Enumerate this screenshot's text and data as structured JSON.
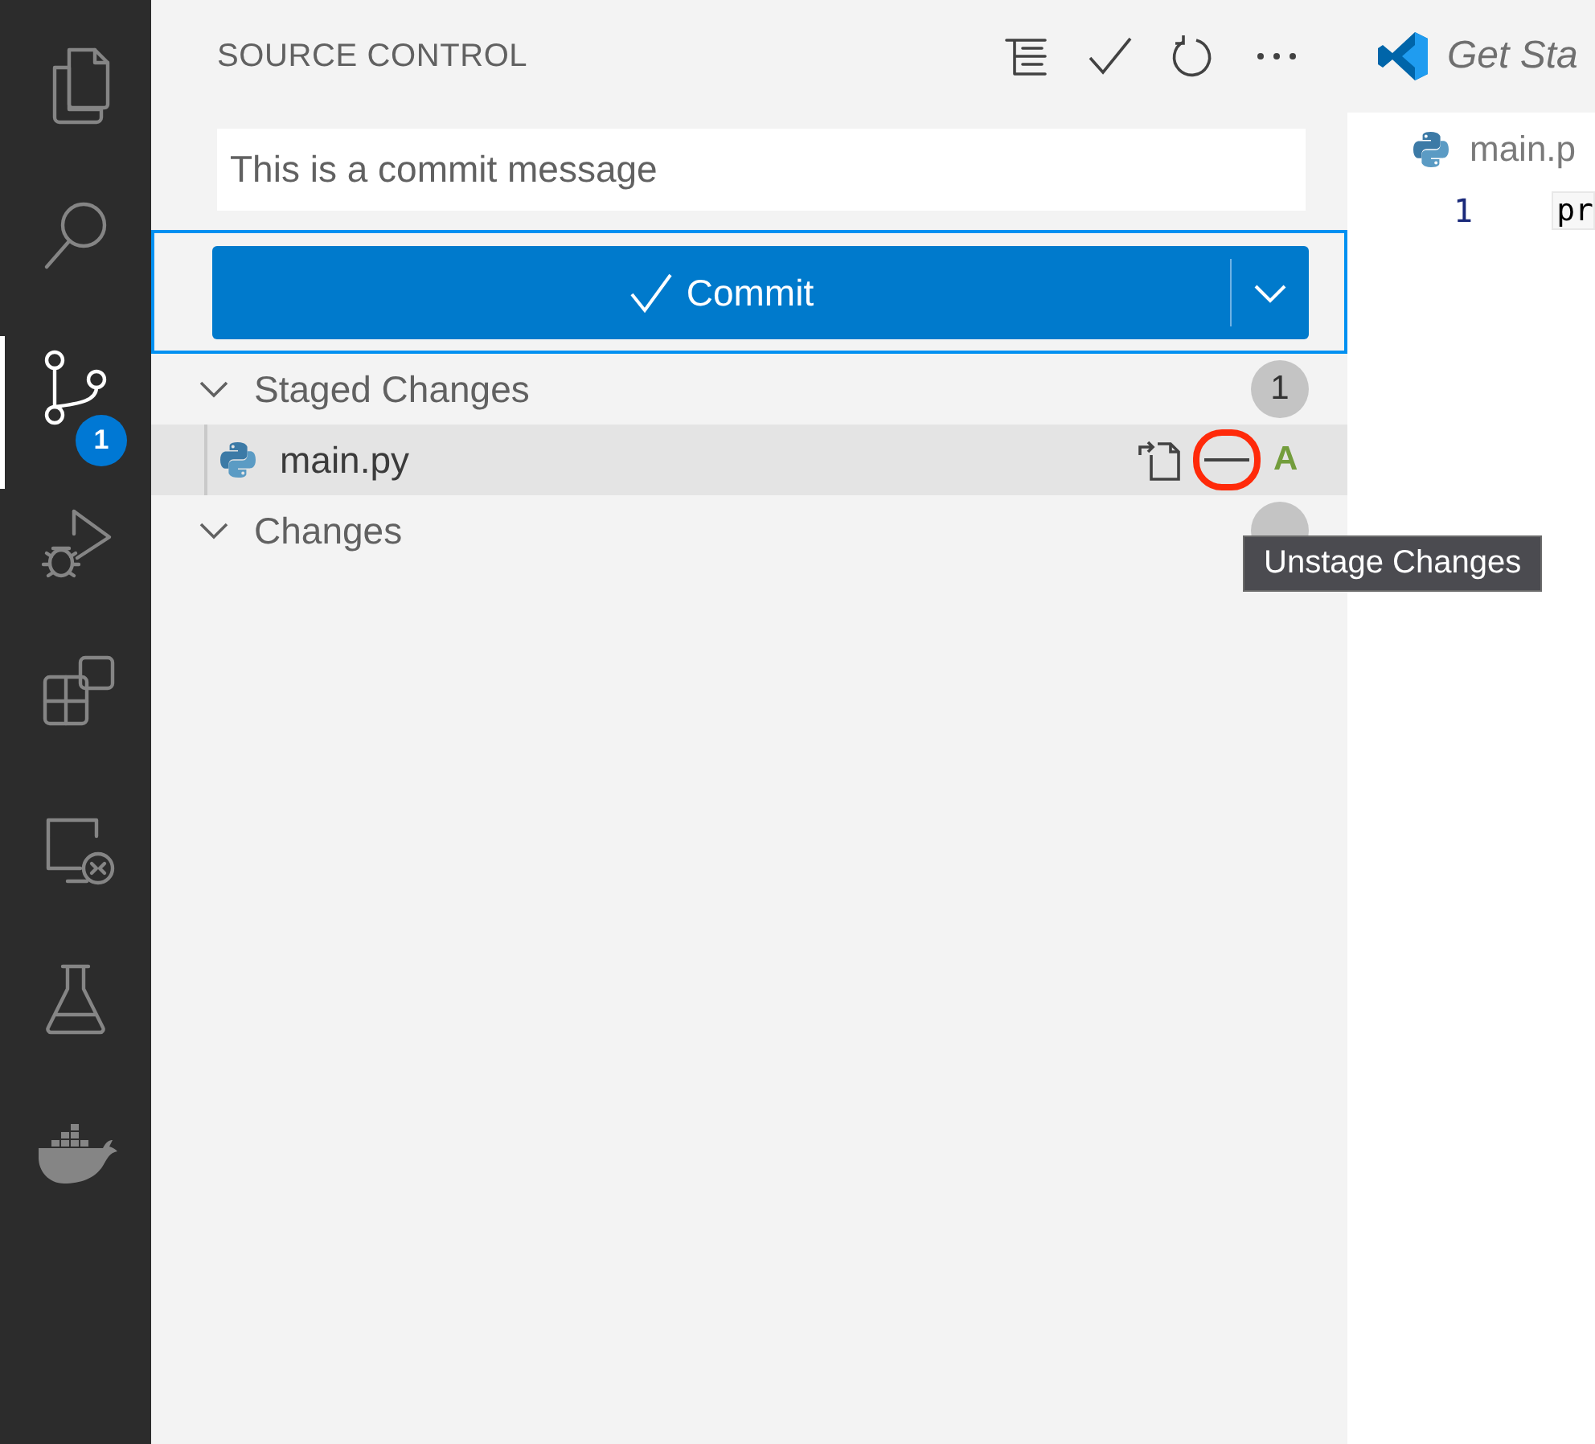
{
  "activity_bar": {
    "items": [
      {
        "selected": false
      },
      {
        "selected": false
      },
      {
        "selected": true,
        "badge": "1"
      },
      {
        "selected": false
      },
      {
        "selected": false
      },
      {
        "selected": false
      },
      {
        "selected": false
      },
      {
        "selected": false
      }
    ]
  },
  "sidebar": {
    "title": "SOURCE CONTROL",
    "commit_message": {
      "value": "This is a commit message"
    },
    "commit_button": {
      "label": "Commit",
      "focused": true
    },
    "groups": [
      {
        "label": "Staged Changes",
        "expanded": true,
        "count": "1",
        "files": [
          {
            "name": "main.py",
            "status": "A",
            "hovered": true,
            "highlighted_action": true
          }
        ]
      },
      {
        "label": "Changes",
        "expanded": true,
        "badge_partly_hidden": true
      }
    ]
  },
  "tooltip": {
    "text": "Unstage Changes"
  },
  "editor": {
    "tab": {
      "label": "Get Sta"
    },
    "breadcrumb": "main.p",
    "lines": [
      {
        "number": "1",
        "text": "pr"
      }
    ]
  }
}
